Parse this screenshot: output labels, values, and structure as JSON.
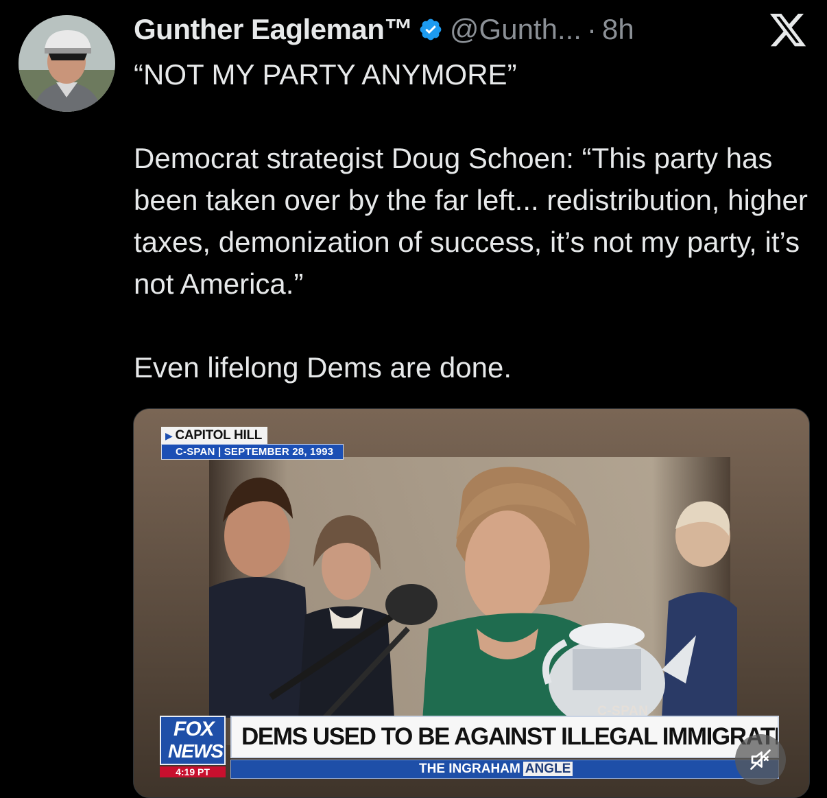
{
  "tweet": {
    "author": {
      "display_name": "Gunther Eagleman™",
      "handle": "@Gunth...",
      "verified": true
    },
    "separator": "·",
    "time": "8h",
    "text": {
      "p1": "“NOT MY PARTY ANYMORE”",
      "p2": "Democrat strategist Doug Schoen: “This party has been taken over by the far left... redistribution, higher taxes, demonization of success, it’s not my party, it’s not America.”",
      "p3": "Even lifelong Dems are done."
    }
  },
  "media": {
    "location_label": "CAPITOL HILL",
    "source_label": "C-SPAN | SEPTEMBER 28, 1993",
    "watermark": "C-SPAN",
    "network": {
      "line1": "FOX",
      "line2": "NEWS",
      "time": "4:19 PT"
    },
    "chyron": "DEMS USED TO BE AGAINST ILLEGAL IMMIGRATION",
    "show": {
      "prefix": "THE INGRAHAM",
      "suffix": "ANGLE"
    }
  },
  "icons": {
    "brand": "x-logo-icon",
    "verified": "verified-badge-icon",
    "mute": "muted-speaker-icon"
  },
  "colors": {
    "background": "#000000",
    "text_primary": "#e7e9ea",
    "text_secondary": "#8b9096",
    "verified_blue": "#1d9bf0",
    "fox_blue": "#1f4fa8",
    "fox_red": "#c8102e"
  }
}
